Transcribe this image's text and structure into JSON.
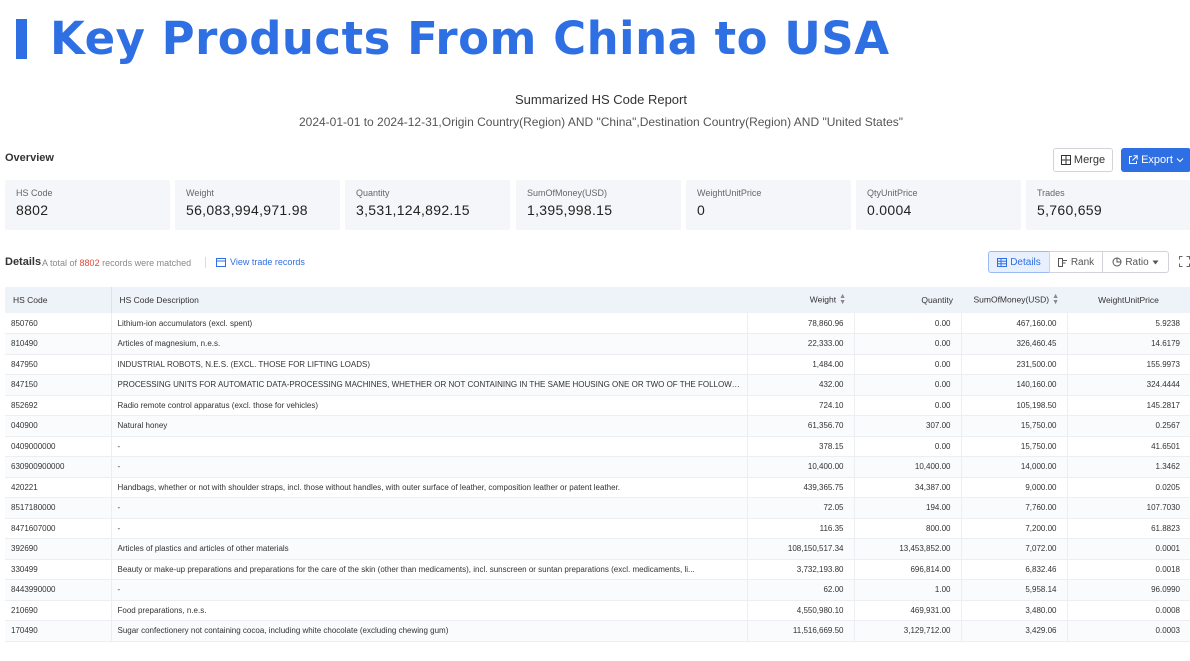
{
  "hero": {
    "title": "Key Products From China to USA"
  },
  "report": {
    "title": "Summarized HS Code Report",
    "subtitle": "2024-01-01 to 2024-12-31,Origin Country(Region) AND \"China\",Destination Country(Region) AND \"United States\""
  },
  "overview": {
    "label": "Overview",
    "merge_label": "Merge",
    "export_label": "Export",
    "stats": [
      {
        "label": "HS Code",
        "value": "8802"
      },
      {
        "label": "Weight",
        "value": "56,083,994,971.98"
      },
      {
        "label": "Quantity",
        "value": "3,531,124,892.15"
      },
      {
        "label": "SumOfMoney(USD)",
        "value": "1,395,998.15"
      },
      {
        "label": "WeightUnitPrice",
        "value": "0"
      },
      {
        "label": "QtyUnitPrice",
        "value": "0.0004"
      },
      {
        "label": "Trades",
        "value": "5,760,659"
      }
    ]
  },
  "details": {
    "label": "Details",
    "count_prefix": "A total of",
    "count": "8802",
    "count_suffix": "records were matched",
    "view_link": "View trade records",
    "tabs": {
      "details": "Details",
      "rank": "Rank",
      "ratio": "Ratio"
    }
  },
  "table": {
    "headers": {
      "hs_code": "HS Code",
      "description": "HS Code Description",
      "weight": "Weight",
      "quantity": "Quantity",
      "sum": "SumOfMoney(USD)",
      "wup": "WeightUnitPrice"
    },
    "rows": [
      {
        "code": "850760",
        "desc": "Lithium-ion accumulators (excl. spent)",
        "weight": "78,860.96",
        "qty": "0.00",
        "sum": "467,160.00",
        "wup": "5.9238"
      },
      {
        "code": "810490",
        "desc": "Articles of magnesium, n.e.s.",
        "weight": "22,333.00",
        "qty": "0.00",
        "sum": "326,460.45",
        "wup": "14.6179"
      },
      {
        "code": "847950",
        "desc": "INDUSTRIAL ROBOTS, N.E.S. (EXCL. THOSE FOR LIFTING LOADS)",
        "weight": "1,484.00",
        "qty": "0.00",
        "sum": "231,500.00",
        "wup": "155.9973"
      },
      {
        "code": "847150",
        "desc": "PROCESSING UNITS FOR AUTOMATIC DATA-PROCESSING MACHINES, WHETHER OR NOT CONTAINING IN THE SAME HOUSING ONE OR TWO OF THE FOLLOWIN...",
        "weight": "432.00",
        "qty": "0.00",
        "sum": "140,160.00",
        "wup": "324.4444"
      },
      {
        "code": "852692",
        "desc": "Radio remote control apparatus (excl. those for vehicles)",
        "weight": "724.10",
        "qty": "0.00",
        "sum": "105,198.50",
        "wup": "145.2817"
      },
      {
        "code": "040900",
        "desc": "Natural honey",
        "weight": "61,356.70",
        "qty": "307.00",
        "sum": "15,750.00",
        "wup": "0.2567"
      },
      {
        "code": "0409000000",
        "desc": "-",
        "weight": "378.15",
        "qty": "0.00",
        "sum": "15,750.00",
        "wup": "41.6501"
      },
      {
        "code": "630900900000",
        "desc": "-",
        "weight": "10,400.00",
        "qty": "10,400.00",
        "sum": "14,000.00",
        "wup": "1.3462"
      },
      {
        "code": "420221",
        "desc": "Handbags, whether or not with shoulder straps, incl. those without handles, with outer surface of leather, composition leather or patent leather.",
        "weight": "439,365.75",
        "qty": "34,387.00",
        "sum": "9,000.00",
        "wup": "0.0205"
      },
      {
        "code": "8517180000",
        "desc": "-",
        "weight": "72.05",
        "qty": "194.00",
        "sum": "7,760.00",
        "wup": "107.7030"
      },
      {
        "code": "8471607000",
        "desc": "-",
        "weight": "116.35",
        "qty": "800.00",
        "sum": "7,200.00",
        "wup": "61.8823"
      },
      {
        "code": "392690",
        "desc": "Articles of plastics and articles of other materials",
        "weight": "108,150,517.34",
        "qty": "13,453,852.00",
        "sum": "7,072.00",
        "wup": "0.0001"
      },
      {
        "code": "330499",
        "desc": "Beauty or make-up preparations and preparations for the care of the skin (other than medicaments), incl. sunscreen or suntan preparations (excl. medicaments, li...",
        "weight": "3,732,193.80",
        "qty": "696,814.00",
        "sum": "6,832.46",
        "wup": "0.0018"
      },
      {
        "code": "8443990000",
        "desc": "-",
        "weight": "62.00",
        "qty": "1.00",
        "sum": "5,958.14",
        "wup": "96.0990"
      },
      {
        "code": "210690",
        "desc": "Food preparations, n.e.s.",
        "weight": "4,550,980.10",
        "qty": "469,931.00",
        "sum": "3,480.00",
        "wup": "0.0008"
      },
      {
        "code": "170490",
        "desc": "Sugar confectionery not containing cocoa, including white chocolate (excluding chewing gum)",
        "weight": "11,516,669.50",
        "qty": "3,129,712.00",
        "sum": "3,429.06",
        "wup": "0.0003"
      }
    ]
  },
  "colors": {
    "accent": "#2f6fe4",
    "count": "#e0483b"
  }
}
